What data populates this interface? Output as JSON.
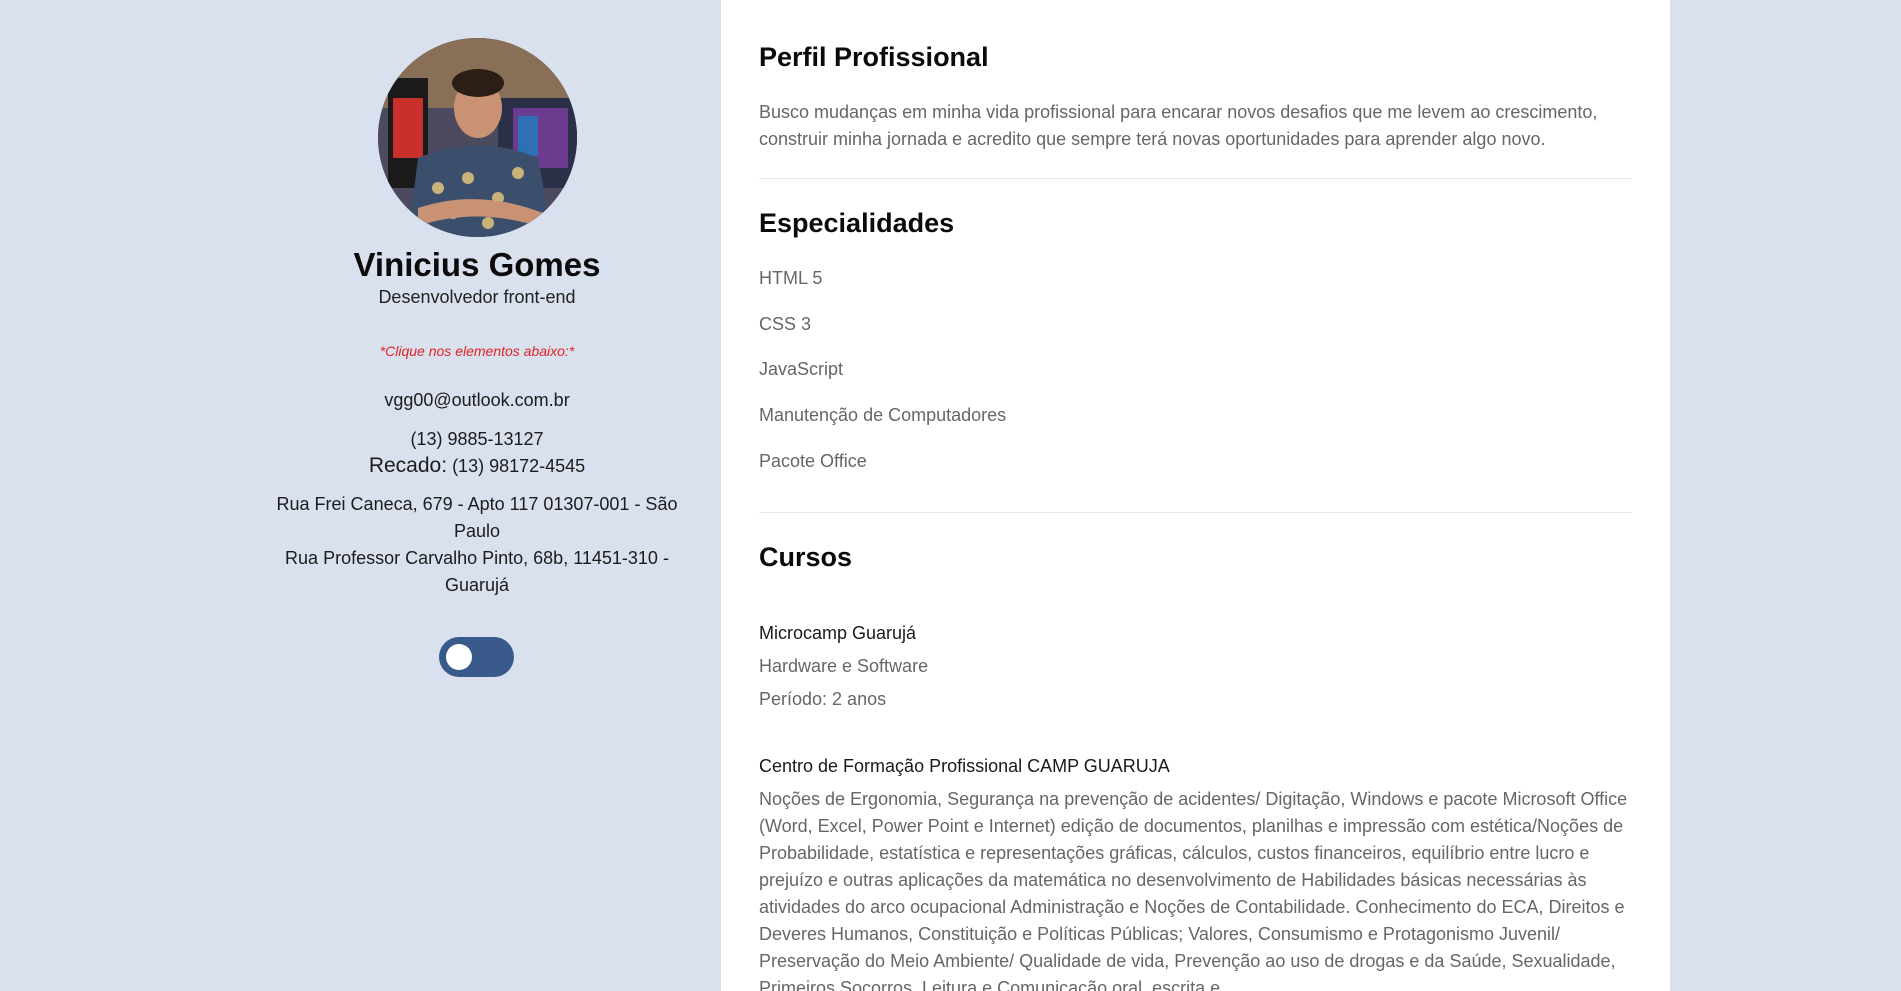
{
  "profile": {
    "name": "Vinicius Gomes",
    "role": "Desenvolvedor front-end",
    "hint": "*Clique nos elementos abaixo:*",
    "email": "vgg00@outlook.com.br",
    "phone": "(13) 9885-13127",
    "recado_label": "Recado:",
    "recado_phone": "(13) 98172-4545",
    "address_1": "Rua Frei Caneca, 679 - Apto 117 01307-001 - São Paulo",
    "address_2": "Rua Professor Carvalho Pinto, 68b, 11451-310 - Guarujá"
  },
  "theme_toggle": {
    "state": "off",
    "color": "#3a5a8c"
  },
  "perfil": {
    "title": "Perfil Profissional",
    "text": "Busco mudanças em minha vida profissional para encarar novos desafios que me levem ao crescimento, construir minha jornada e acredito que sempre terá novas oportunidades para aprender algo novo."
  },
  "especialidades": {
    "title": "Especialidades",
    "items": [
      "HTML 5",
      "CSS 3",
      "JavaScript",
      "Manutenção de Computadores",
      "Pacote Office"
    ]
  },
  "cursos": {
    "title": "Cursos",
    "items": [
      {
        "institution": "Microcamp Guarujá",
        "course": "Hardware e Software",
        "period": "Período: 2 anos"
      },
      {
        "institution": "Centro de Formação Profissional CAMP GUARUJA",
        "description": "Noções de Ergonomia, Segurança na prevenção de acidentes/ Digitação, Windows e pacote Microsoft Office (Word, Excel, Power Point e Internet) edição de documentos, planilhas e impressão com estética/Noções de Probabilidade, estatística e representações gráficas, cálculos, custos financeiros, equilíbrio entre lucro e prejuízo e outras aplicações da matemática no desenvolvimento de Habilidades básicas necessárias às atividades do arco ocupacional Administração e Noções de Contabilidade. Conhecimento do ECA, Direitos e Deveres Humanos, Constituição e Políticas Públicas; Valores, Consumismo e Protagonismo Juvenil/ Preservação do Meio Ambiente/ Qualidade de vida, Prevenção ao uso de drogas e da Saúde, Sexualidade, Primeiros Socorros, Leitura e Comunicação oral, escrita e"
      }
    ]
  }
}
